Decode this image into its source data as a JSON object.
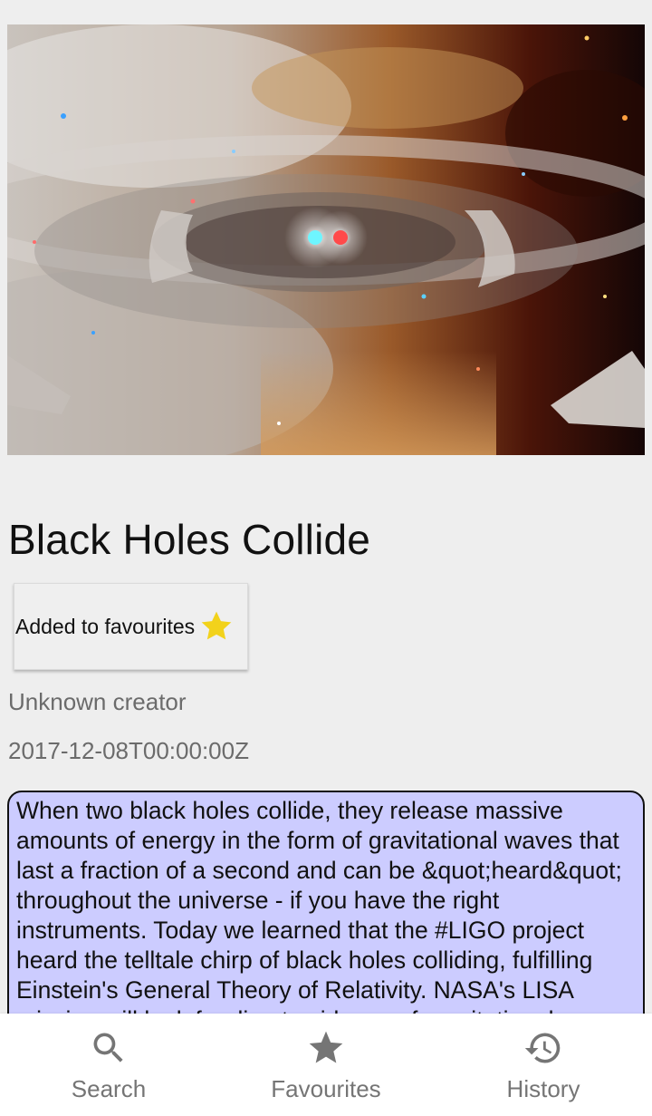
{
  "article": {
    "image_alt": "Black holes collision over starship",
    "title": "Black Holes Collide",
    "favourite_label": "Added to favourites",
    "creator": "Unknown creator",
    "date": "2017-12-08T00:00:00Z",
    "description": "When two black holes collide, they release massive amounts of energy in the form of gravitational waves that last a fraction of a second and can be &quot;heard&quot; throughout the universe - if you have the right instruments.   Today we learned that the #LIGO project heard the telltale chirp of black holes colliding, fulfilling Einstein's General Theory of Relativity.   NASA's LISA mission will look for direct evidence of gravitational waves."
  },
  "nav": {
    "items": [
      {
        "label": "Search",
        "icon": "search-icon"
      },
      {
        "label": "Favourites",
        "icon": "star-icon"
      },
      {
        "label": "History",
        "icon": "history-icon"
      }
    ]
  },
  "colors": {
    "star": "#f2d21b",
    "description_bg": "#ccccff",
    "nav_icon": "#757575"
  }
}
